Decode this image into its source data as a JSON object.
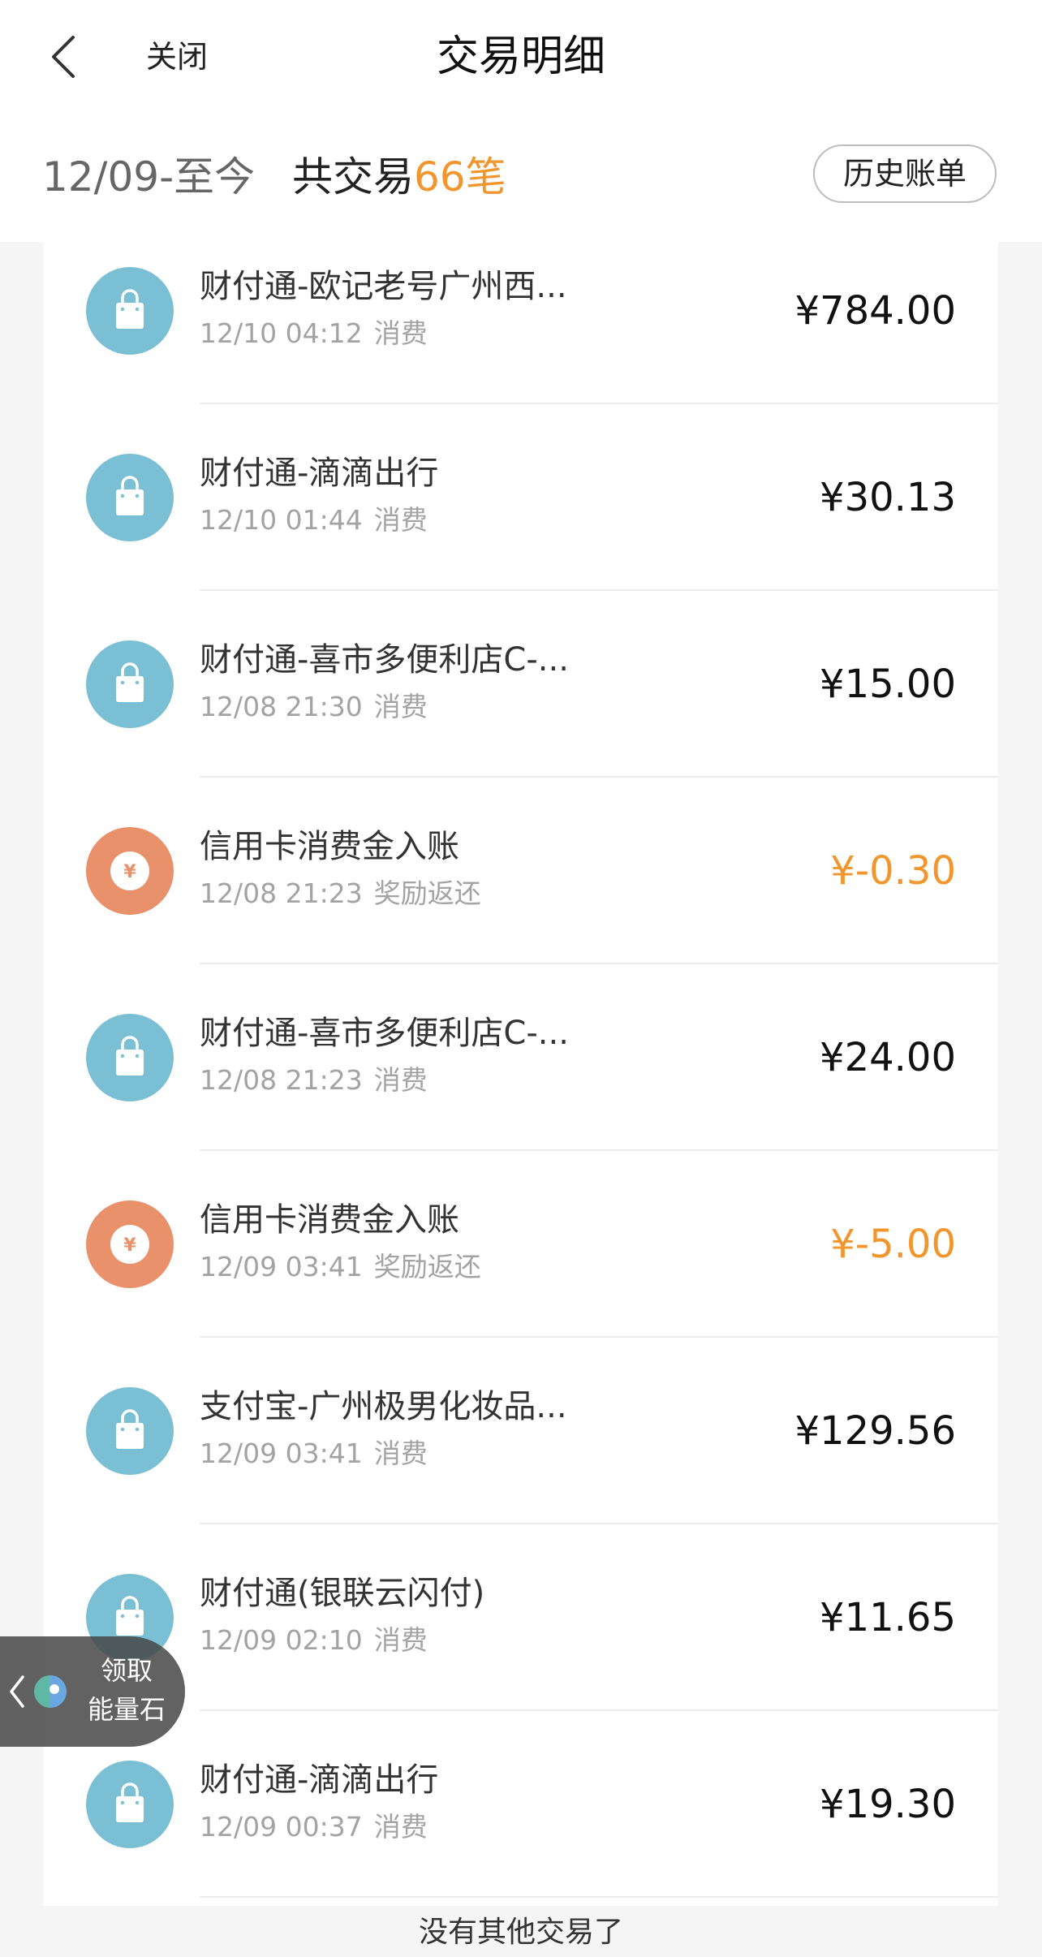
{
  "nav": {
    "close_label": "关闭",
    "title": "交易明细"
  },
  "summary": {
    "period": "12/09-至今",
    "count_prefix": "共交易",
    "count_value": "66笔",
    "history_label": "历史账单"
  },
  "colors": {
    "bag_icon": "#7bbfd5",
    "refund_icon": "#e8916a",
    "accent_orange": "#f0962d"
  },
  "transactions": [
    {
      "icon": "shopping-bag-icon",
      "title": "财付通-欧记老号广州西...",
      "time": "12/10  04:12",
      "type": "消费",
      "amount": "¥784.00",
      "negative": false
    },
    {
      "icon": "shopping-bag-icon",
      "title": "财付通-滴滴出行",
      "time": "12/10  01:44",
      "type": "消费",
      "amount": "¥30.13",
      "negative": false
    },
    {
      "icon": "shopping-bag-icon",
      "title": "财付通-喜市多便利店C-...",
      "time": "12/08  21:30",
      "type": "消费",
      "amount": "¥15.00",
      "negative": false
    },
    {
      "icon": "yen-coin-icon",
      "title": "信用卡消费金入账",
      "time": "12/08  21:23",
      "type": "奖励返还",
      "amount": "¥-0.30",
      "negative": true
    },
    {
      "icon": "shopping-bag-icon",
      "title": "财付通-喜市多便利店C-...",
      "time": "12/08  21:23",
      "type": "消费",
      "amount": "¥24.00",
      "negative": false
    },
    {
      "icon": "yen-coin-icon",
      "title": "信用卡消费金入账",
      "time": "12/09  03:41",
      "type": "奖励返还",
      "amount": "¥-5.00",
      "negative": true
    },
    {
      "icon": "shopping-bag-icon",
      "title": "支付宝-广州极男化妆品...",
      "time": "12/09  03:41",
      "type": "消费",
      "amount": "¥129.56",
      "negative": false
    },
    {
      "icon": "shopping-bag-icon",
      "title": "财付通(银联云闪付)",
      "time": "12/09  02:10",
      "type": "消费",
      "amount": "¥11.65",
      "negative": false
    },
    {
      "icon": "shopping-bag-icon",
      "title": "财付通-滴滴出行",
      "time": "12/09  00:37",
      "type": "消费",
      "amount": "¥19.30",
      "negative": false
    }
  ],
  "footer": "没有其他交易了",
  "floating_widget": {
    "line1": "领取",
    "line2": "能量石"
  }
}
